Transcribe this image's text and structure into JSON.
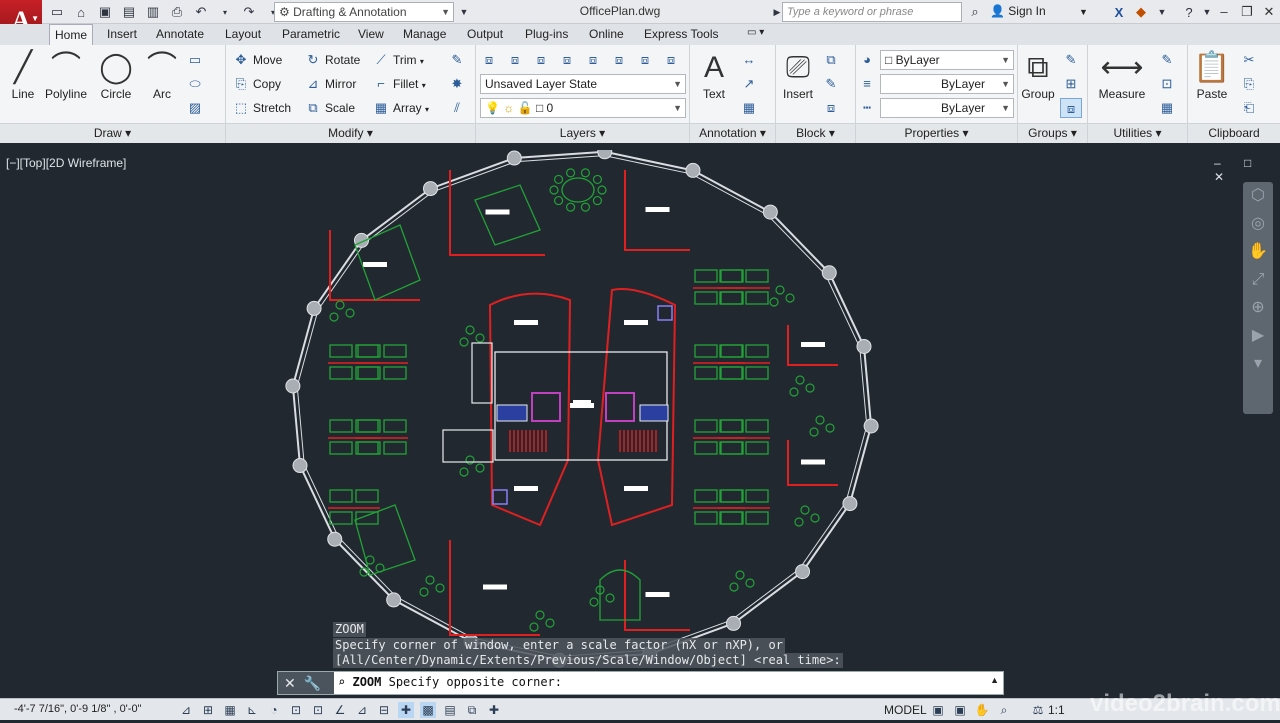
{
  "app": {
    "logo": "A",
    "doc_title": "OfficePlan.dwg",
    "workspace": "Drafting & Annotation",
    "search_placeholder": "Type a keyword or phrase",
    "signin": "Sign In"
  },
  "tabs": [
    "Home",
    "Insert",
    "Annotate",
    "Layout",
    "Parametric",
    "View",
    "Manage",
    "Output",
    "Plug-ins",
    "Online",
    "Express Tools"
  ],
  "panels": {
    "draw": {
      "title": "Draw",
      "tools": [
        "Line",
        "Polyline",
        "Circle",
        "Arc"
      ]
    },
    "modify": {
      "title": "Modify",
      "tools": [
        "Move",
        "Rotate",
        "Trim",
        "Copy",
        "Mirror",
        "Fillet",
        "Stretch",
        "Scale",
        "Array"
      ]
    },
    "layers": {
      "title": "Layers",
      "layer_state": "Unsaved Layer State",
      "current_layer": "0"
    },
    "annotation": {
      "title": "Annotation",
      "tool": "Text"
    },
    "block": {
      "title": "Block",
      "tool": "Insert"
    },
    "properties": {
      "title": "Properties",
      "color": "ByLayer",
      "linetype": "ByLayer",
      "lineweight": "ByLayer"
    },
    "groups": {
      "title": "Groups",
      "tool": "Group"
    },
    "utilities": {
      "title": "Utilities",
      "tool": "Measure"
    },
    "clipboard": {
      "title": "Clipboard",
      "tool": "Paste"
    }
  },
  "viewport": {
    "label": "[−][Top][2D Wireframe]",
    "controls": "– □ ✕"
  },
  "command": {
    "history": [
      "ZOOM",
      "Specify corner of window, enter a scale factor (nX or nXP), or",
      "[All/Center/Dynamic/Extents/Previous/Scale/Window/Object] <real time>:"
    ],
    "prompt_cmd": "ZOOM",
    "prompt_text": "Specify opposite corner:"
  },
  "status": {
    "coords": "-4'-7 7/16\", 0'-9 1/8\" , 0'-0\"",
    "model": "MODEL",
    "scale": "1:1"
  },
  "watermark": "video2brain.com",
  "colors": {
    "drawing_bg": "#212830",
    "walls": "#e02020",
    "furniture": "#22a336",
    "outline": "#d9dde2"
  }
}
